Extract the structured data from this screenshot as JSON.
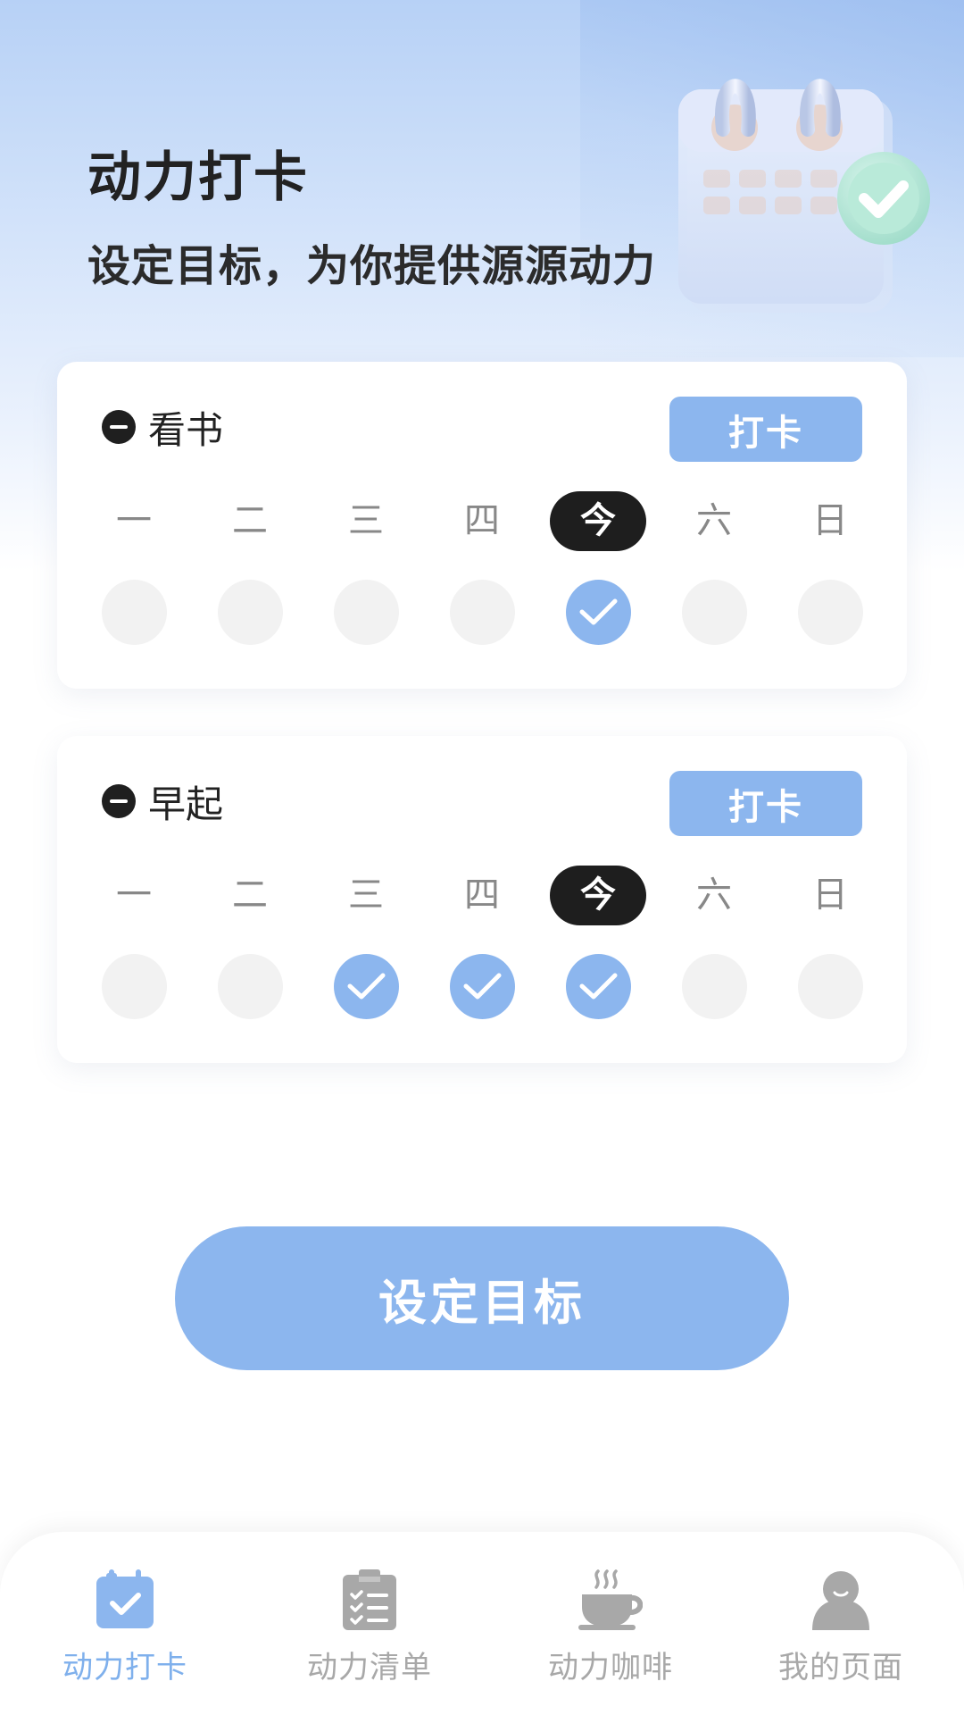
{
  "header": {
    "title": "动力打卡",
    "subtitle": "设定目标，为你提供源源动力"
  },
  "checkin_label": "打卡",
  "habits": [
    {
      "name": "早起",
      "days": [
        "一",
        "二",
        "三",
        "四",
        "今",
        "六",
        "日"
      ],
      "today_index": 4,
      "completed": [
        false,
        false,
        true,
        true,
        true,
        false,
        false
      ]
    },
    {
      "name": "看书",
      "days": [
        "一",
        "二",
        "三",
        "四",
        "今",
        "六",
        "日"
      ],
      "today_index": 4,
      "completed": [
        false,
        false,
        false,
        false,
        true,
        false,
        false
      ]
    }
  ],
  "set_goal_label": "设定目标",
  "tabs": [
    {
      "label": "动力打卡",
      "icon": "calendar-check-icon",
      "active": true
    },
    {
      "label": "动力清单",
      "icon": "clipboard-list-icon",
      "active": false
    },
    {
      "label": "动力咖啡",
      "icon": "coffee-cup-icon",
      "active": false
    },
    {
      "label": "我的页面",
      "icon": "user-icon",
      "active": false
    }
  ],
  "colors": {
    "accent": "#8cb6ee",
    "tab_active": "#7fb0ec",
    "tab_inactive": "#a8a8a8",
    "today_pill": "#1e1e1e",
    "dot_empty": "#f2f2f2"
  }
}
